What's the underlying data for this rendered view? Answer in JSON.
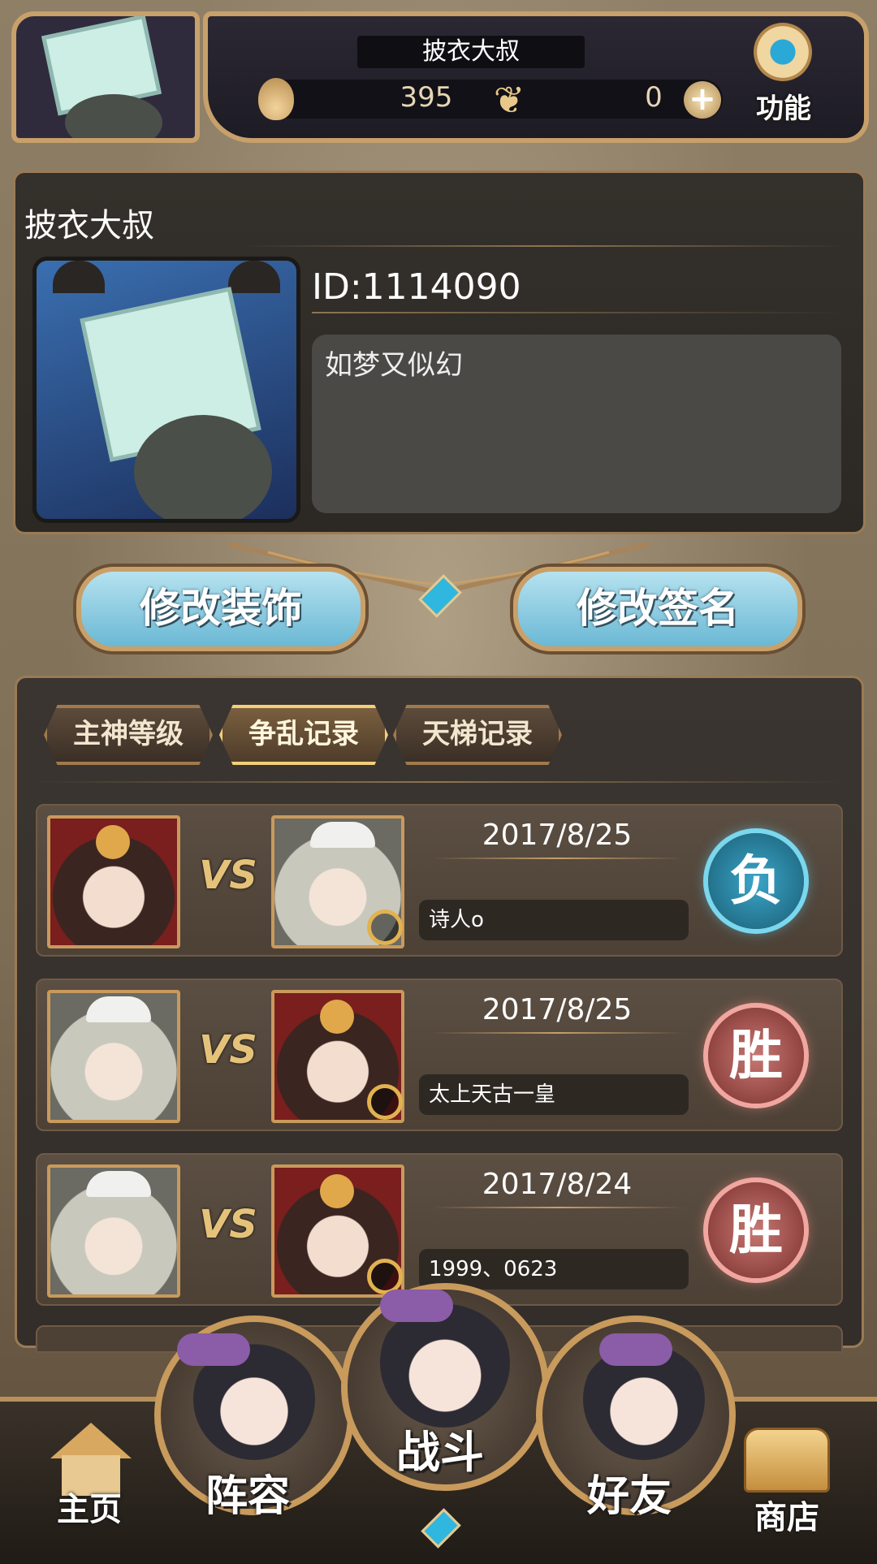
{
  "header": {
    "player_name": "披衣大叔",
    "currency_flame": "395",
    "currency_butterfly": "0",
    "function_label": "功能",
    "icons": [
      "avatar",
      "flame-icon",
      "butterfly-icon",
      "plus-icon",
      "gear-icon"
    ]
  },
  "profile": {
    "name": "披衣大叔",
    "id": "ID:1114090",
    "signature": "如梦又似幻"
  },
  "actions": {
    "edit_decoration": "修改装饰",
    "edit_signature": "修改签名"
  },
  "tabs": [
    {
      "label": "主神等级",
      "active": false
    },
    {
      "label": "争乱记录",
      "active": true
    },
    {
      "label": "天梯记录",
      "active": false
    }
  ],
  "records": [
    {
      "vs": "VS",
      "date": "2017/8/25",
      "opponent": "诗人o",
      "result": "负"
    },
    {
      "vs": "VS",
      "date": "2017/8/25",
      "opponent": "太上天古一皇",
      "result": "胜"
    },
    {
      "vs": "VS",
      "date": "2017/8/24",
      "opponent": "1999、0623",
      "result": "胜"
    }
  ],
  "nav": {
    "home": "主页",
    "lineup": "阵容",
    "battle": "战斗",
    "friends": "好友",
    "shop": "商店"
  },
  "colors": {
    "accent_gold": "#c7a06a",
    "button_blue": "#6bb8d5",
    "lose_blue": "#3aa6c8",
    "win_red": "#c77873"
  }
}
